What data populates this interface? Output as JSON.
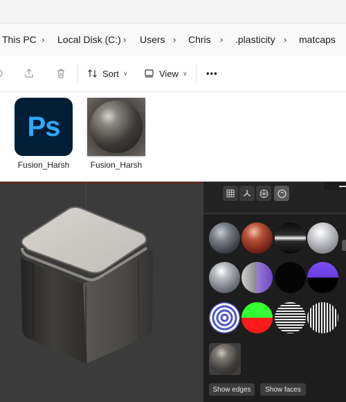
{
  "explorer": {
    "breadcrumb": [
      "This PC",
      "Local Disk (C:)",
      "Users",
      "Chris",
      ".plasticity",
      "matcaps"
    ],
    "toolbar": {
      "sort_label": "Sort",
      "view_label": "View",
      "more_label": "•••"
    },
    "files": [
      {
        "name": "Fusion_Harsh",
        "icon": "photoshop-file-icon",
        "icon_text": "Ps"
      },
      {
        "name": "Fusion_Harsh",
        "icon": "matcap-thumbnail"
      }
    ]
  },
  "viewport": {
    "panel": {
      "buttons": [
        {
          "name": "grid-icon"
        },
        {
          "name": "axes-icon"
        },
        {
          "name": "wireframe-sphere-icon"
        },
        {
          "name": "matcap-sphere-icon",
          "active": true
        }
      ],
      "show_edges_label": "Show edges",
      "show_faces_label": "Show faces"
    }
  }
}
